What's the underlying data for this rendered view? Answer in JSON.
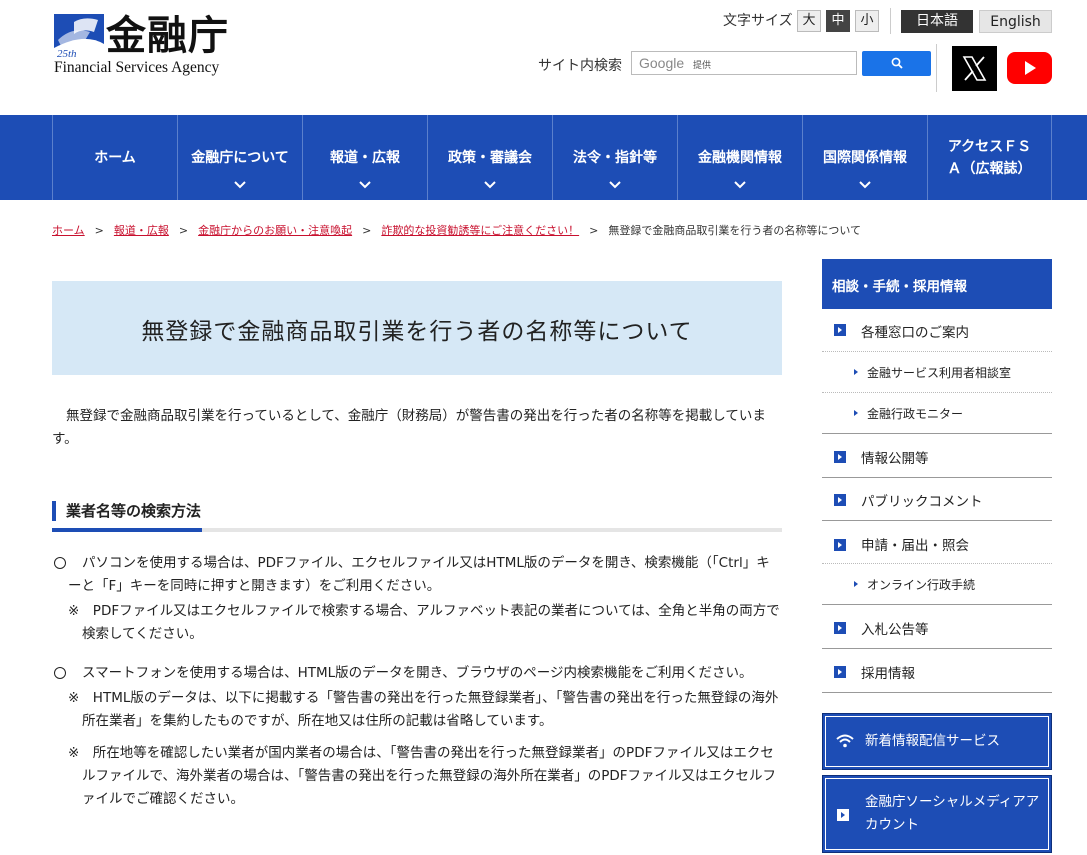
{
  "header": {
    "logo_title": "金融庁",
    "logo_sub": "Financial Services Agency",
    "logo_badge": "25th",
    "fontsize_label": "文字サイズ",
    "fontsize": {
      "large": "大",
      "medium": "中",
      "small": "小",
      "selected": "中"
    },
    "lang_ja": "日本語",
    "lang_en": "English",
    "search_label": "サイト内検索",
    "search_google": "Google",
    "search_provided": "提供",
    "search_value": ""
  },
  "nav": [
    {
      "label": "ホーム"
    },
    {
      "label": "金融庁について"
    },
    {
      "label": "報道・広報"
    },
    {
      "label": "政策・審議会"
    },
    {
      "label": "法令・指針等"
    },
    {
      "label": "金融機関情報"
    },
    {
      "label": "国際関係情報"
    },
    {
      "label": "アクセスＦＳＡ（広報誌）"
    }
  ],
  "breadcrumb": {
    "home": "ホーム",
    "c1": "報道・広報",
    "c2": "金融庁からのお願い・注意喚起",
    "c3": "詐欺的な投資勧誘等にご注意ください！",
    "current": "無登録で金融商品取引業を行う者の名称等について",
    "sep": ">"
  },
  "main": {
    "title": "無登録で金融商品取引業を行う者の名称等について",
    "intro": "無登録で金融商品取引業を行っているとして、金融庁（財務局）が警告書の発出を行った者の名称等を掲載しています。",
    "section_title": "業者名等の検索方法",
    "bullet1": "パソコンを使用する場合は、PDFファイル、エクセルファイル又はHTML版のデータを開き、検索機能（「Ctrl」キーと「F」キーを同時に押すと開きます）をご利用ください。",
    "note1": "※　PDFファイル又はエクセルファイルで検索する場合、アルファベット表記の業者については、全角と半角の両方で検索してください。",
    "bullet2": "スマートフォンを使用する場合は、HTML版のデータを開き、ブラウザのページ内検索機能をご利用ください。",
    "note2": "※　HTML版のデータは、以下に掲載する「警告書の発出を行った無登録業者」、「警告書の発出を行った無登録の海外所在業者」を集約したものですが、所在地又は住所の記載は省略しています。",
    "note3": "※　所在地等を確認したい業者が国内業者の場合は、「警告書の発出を行った無登録業者」のPDFファイル又はエクセルファイルで、海外業者の場合は、「警告書の発出を行った無登録の海外所在業者」のPDFファイル又はエクセルファイルでご確認ください。"
  },
  "sidebar": {
    "heading": "相談・手続・採用情報",
    "items": [
      {
        "label": "各種窓口のご案内"
      },
      {
        "label": "金融サービス利用者相談室"
      },
      {
        "label": "金融行政モニター"
      },
      {
        "label": "情報公開等"
      },
      {
        "label": "パブリックコメント"
      },
      {
        "label": "申請・届出・照会"
      },
      {
        "label": "オンライン行政手続"
      },
      {
        "label": "入札公告等"
      },
      {
        "label": "採用情報"
      }
    ],
    "rss_label": "新着情報配信サービス",
    "social_label": "金融庁ソーシャルメディアアカウント"
  },
  "colors": {
    "nav_blue": "#1d4db5",
    "title_bg": "#d6e8f6",
    "breadcrumb_link": "#c8102e"
  }
}
